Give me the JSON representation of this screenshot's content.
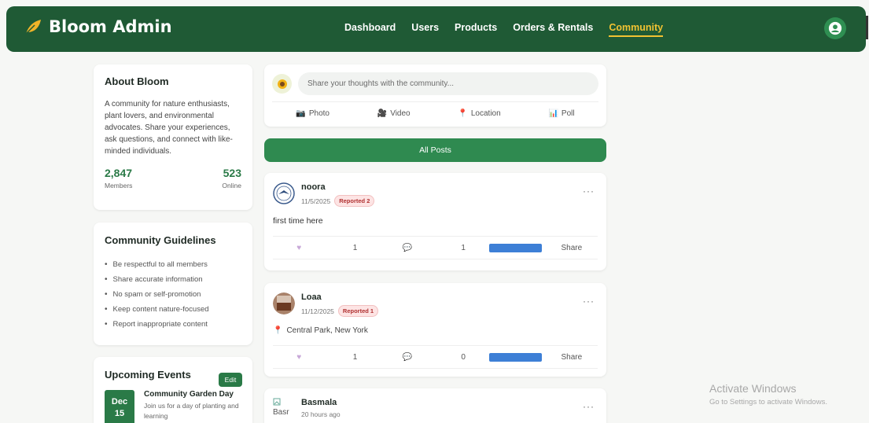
{
  "brand": {
    "name": "Bloom Admin",
    "icon": "leaf-icon"
  },
  "nav": {
    "items": [
      "Dashboard",
      "Users",
      "Products",
      "Orders & Rentals",
      "Community"
    ],
    "active": "Community"
  },
  "about": {
    "title": "About Bloom",
    "description": "A community for nature enthusiasts, plant lovers, and environmental advocates. Share your experiences, ask questions, and connect with like-minded individuals.",
    "members_count": "2,847",
    "members_label": "Members",
    "online_count": "523",
    "online_label": "Online"
  },
  "guidelines": {
    "title": "Community Guidelines",
    "items": [
      "Be respectful to all members",
      "Share accurate information",
      "No spam or self-promotion",
      "Keep content nature-focused",
      "Report inappropriate content"
    ]
  },
  "events": {
    "title": "Upcoming Events",
    "edit_label": "Edit",
    "items": [
      {
        "month": "Dec",
        "day": "15",
        "title": "Community Garden Day",
        "description": "Join us for a day of planting and learning"
      }
    ]
  },
  "composer": {
    "placeholder": "Share your thoughts with the community...",
    "actions": [
      "Photo",
      "Video",
      "Location",
      "Poll"
    ]
  },
  "filter": {
    "label": "All Posts"
  },
  "posts": [
    {
      "author": "noora",
      "date": "11/5/2025",
      "badge": "Reported 2",
      "text": "first time here",
      "likes": "1",
      "comments": "1",
      "share_label": "Share"
    },
    {
      "author": "Loaa",
      "date": "11/12/2025",
      "badge": "Reported 1",
      "location": "Central Park, New York",
      "likes": "1",
      "comments": "0",
      "share_label": "Share"
    },
    {
      "author": "Basmala",
      "date": "20 hours ago",
      "avatar_alt": "Basr"
    }
  ],
  "watermark": {
    "line1": "Activate Windows",
    "line2": "Go to Settings to activate Windows."
  },
  "colors": {
    "header": "#1f5a35",
    "accent": "#2a7a47",
    "active_nav": "#f1c232",
    "badge": "#b03030"
  }
}
